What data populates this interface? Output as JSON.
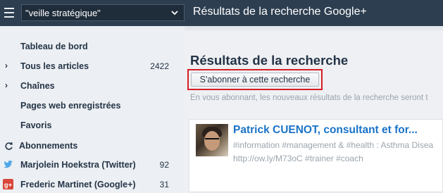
{
  "topbar": {
    "search_value": "\"veille stratégique\"",
    "page_title": "Résultats de la recherche Google+"
  },
  "sidebar": {
    "dashboard": "Tableau de bord",
    "all_articles": "Tous les articles",
    "all_articles_count": "2422",
    "channels": "Chaînes",
    "saved_pages": "Pages web enregistrées",
    "favorites": "Favoris",
    "subscriptions": "Abonnements",
    "subs": [
      {
        "name": "Marjolein Hoekstra (Twitter)",
        "count": "92",
        "icon": "twitter-icon"
      },
      {
        "name": "Frederic Martinet (Google+)",
        "count": "31",
        "icon": "google-plus-icon"
      }
    ]
  },
  "main": {
    "results_title": "Résultats de la recherche",
    "subscribe_label": "S'abonner à cette recherche",
    "hint": "En vous abonnant, les nouveaux résultats de la recherche seront t",
    "result": {
      "title": "Patrick CUENOT, consultant et for...",
      "tags": "#information #management & #health : Asthma Disea",
      "link": "http://ow.ly/M73oC #trainer #coach"
    }
  },
  "colors": {
    "topbar": "#2d3e50",
    "accent_red": "#d61f26",
    "link_blue": "#1a73c8"
  }
}
